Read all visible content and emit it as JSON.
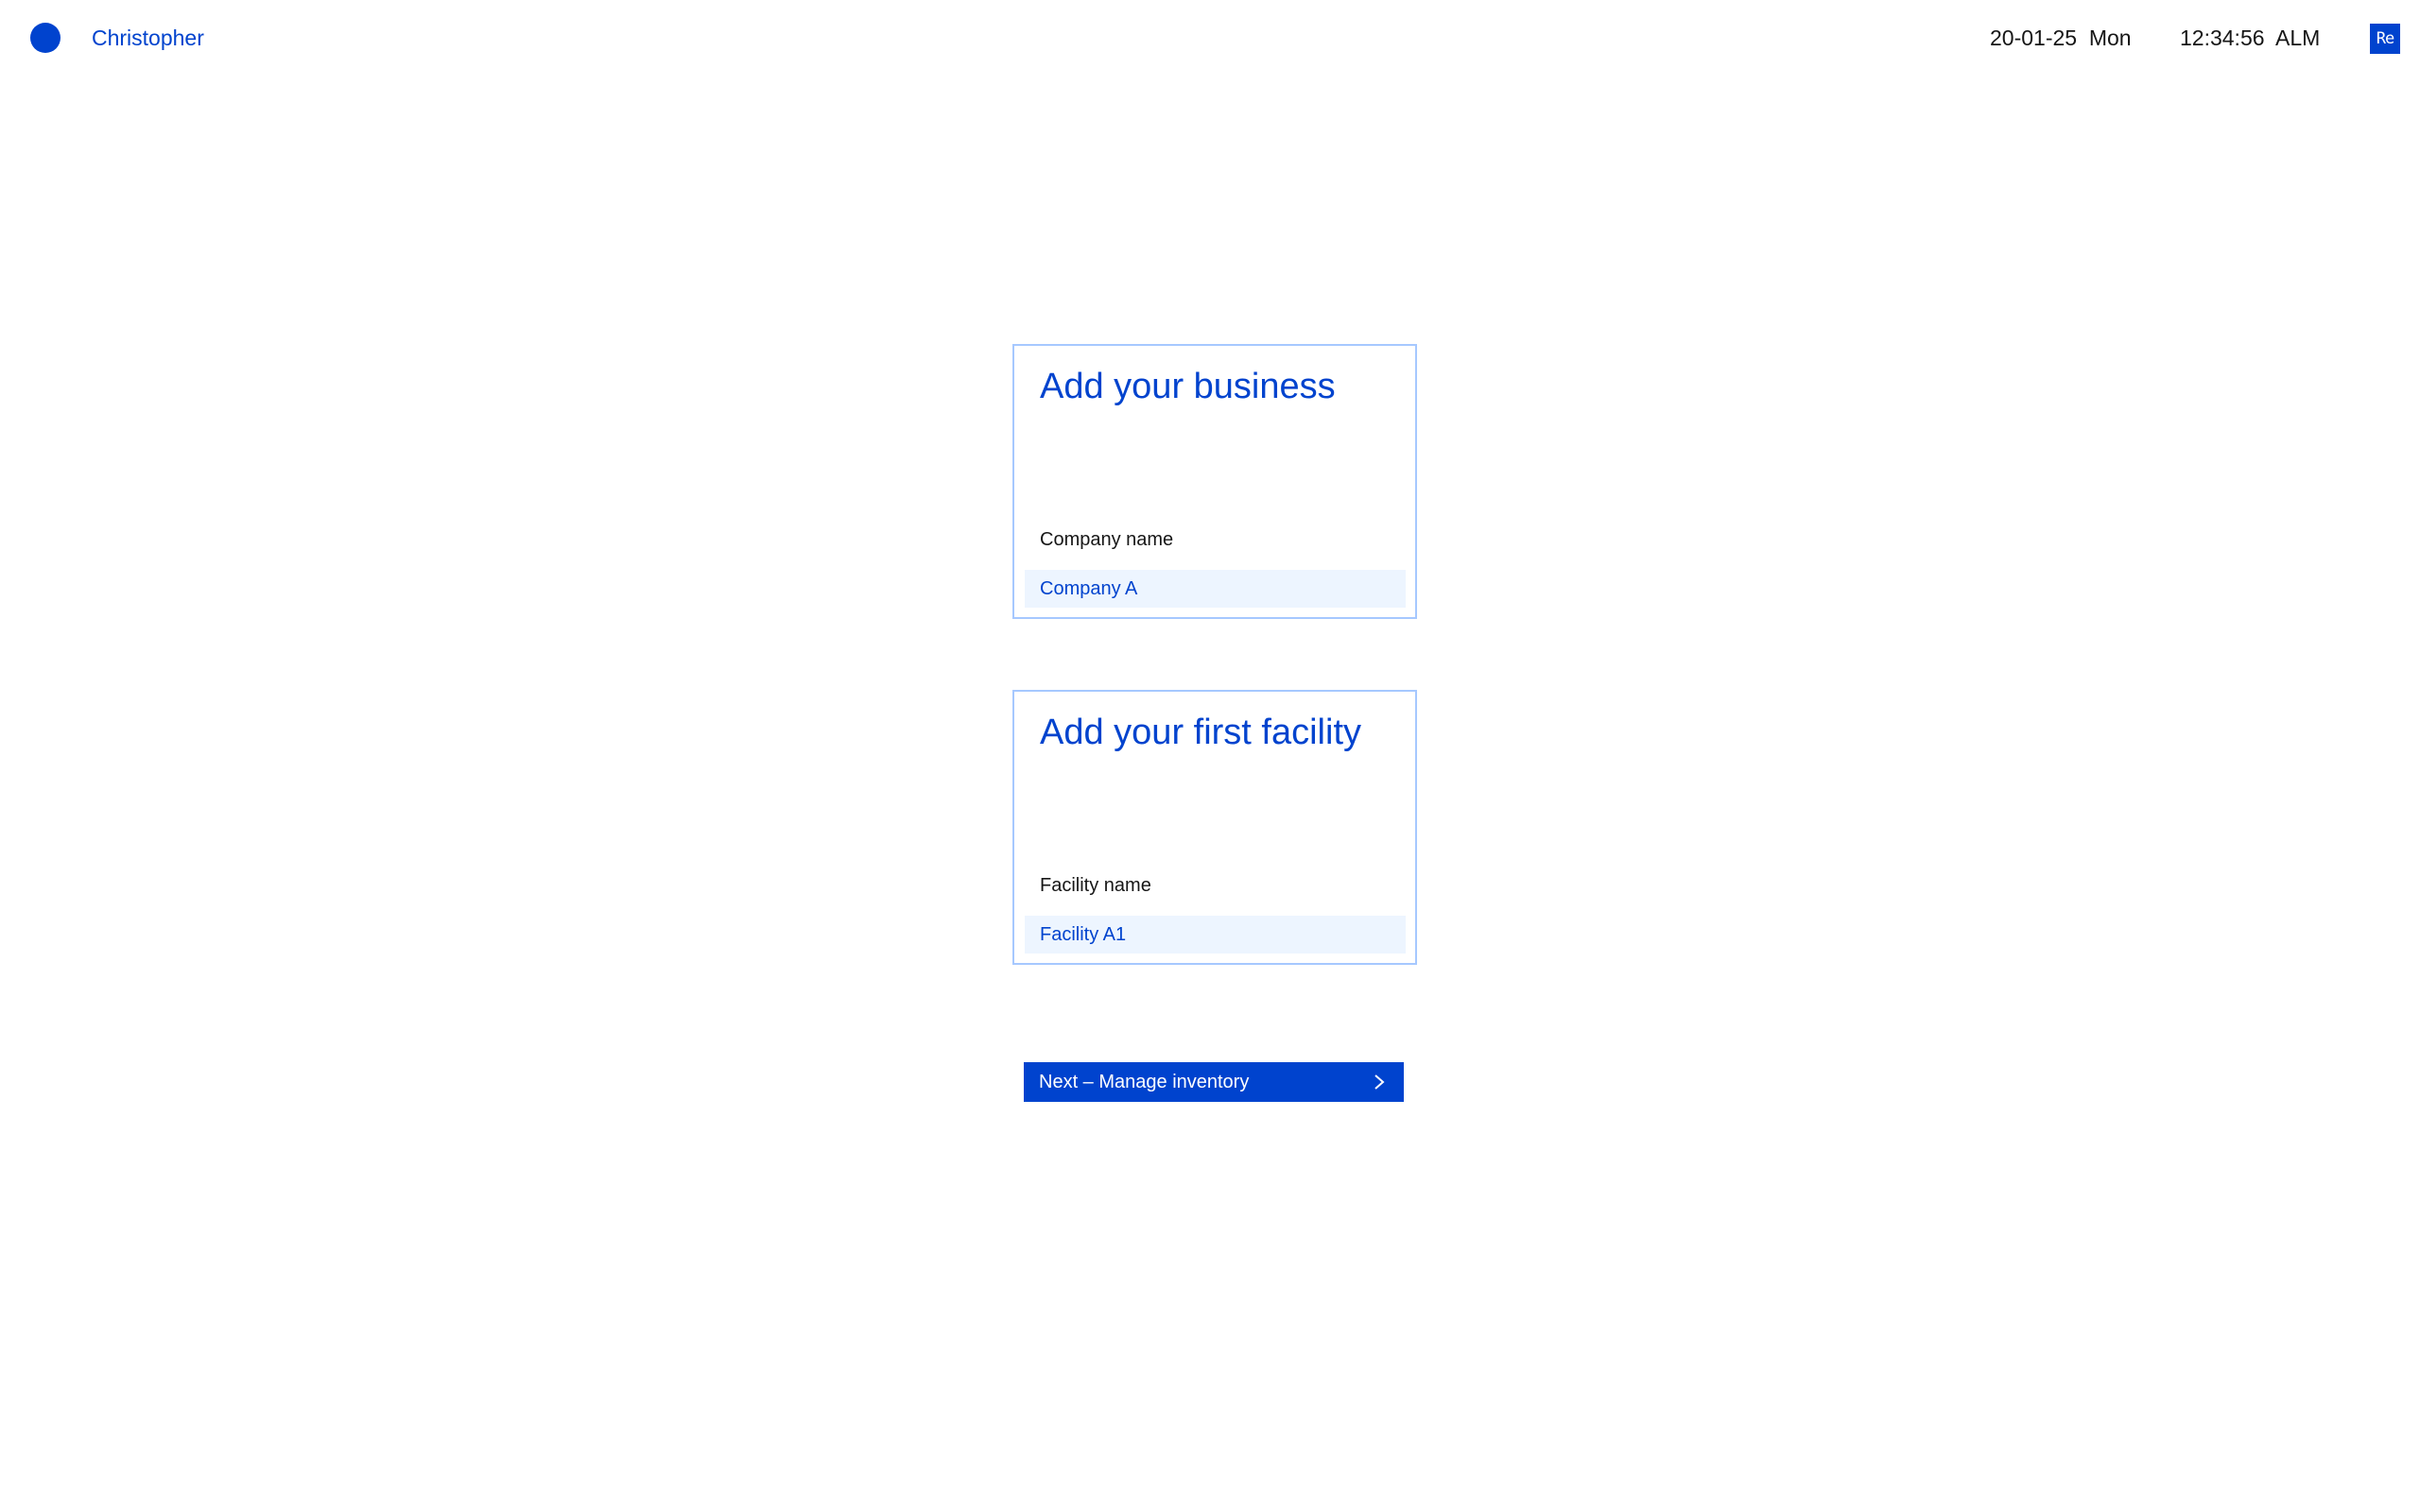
{
  "colors": {
    "accent": "#0043ce",
    "card_border": "#a6c8ff",
    "input_background": "#edf5ff",
    "text": "#161616"
  },
  "header": {
    "avatar_icon": "user-avatar-circle",
    "username": "Christopher",
    "date": "20-01-25  Mon",
    "time": "12:34:56  ALM",
    "brand_badge": "Re"
  },
  "business_card": {
    "title": "Add your business",
    "field_label": "Company name",
    "field_value": "Company A"
  },
  "facility_card": {
    "title": "Add your first facility",
    "field_label": "Facility name",
    "field_value": "Facility A1"
  },
  "next_button": {
    "label": "Next – Manage inventory",
    "icon": "chevron-right-icon"
  }
}
